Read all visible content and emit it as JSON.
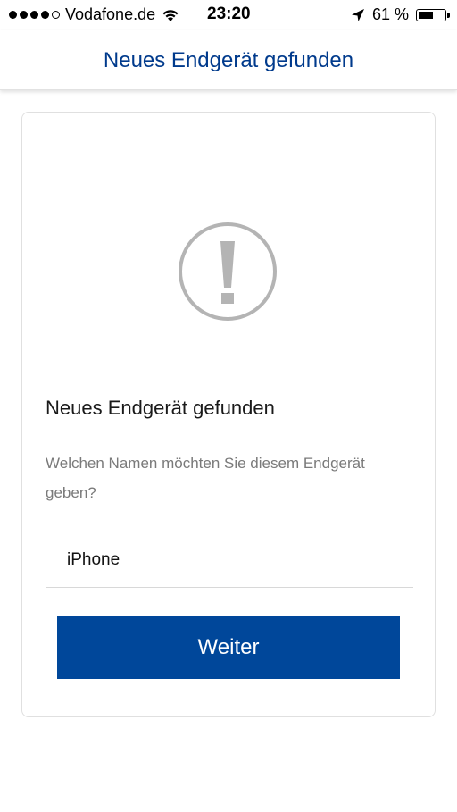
{
  "status_bar": {
    "carrier": "Vodafone.de",
    "time": "23:20",
    "battery_percent": "61 %",
    "battery_level": 0.61
  },
  "nav": {
    "title": "Neues Endgerät gefunden"
  },
  "card": {
    "icon": "warning-circle-icon",
    "heading": "Neues Endgerät gefunden",
    "description": "Welchen Namen möchten Sie diesem Endgerät geben?",
    "name_input_value": "iPhone",
    "continue_label": "Weiter"
  },
  "colors": {
    "brand_blue": "#003a8c",
    "button_blue": "#00479a",
    "icon_gray": "#b4b4b4"
  }
}
